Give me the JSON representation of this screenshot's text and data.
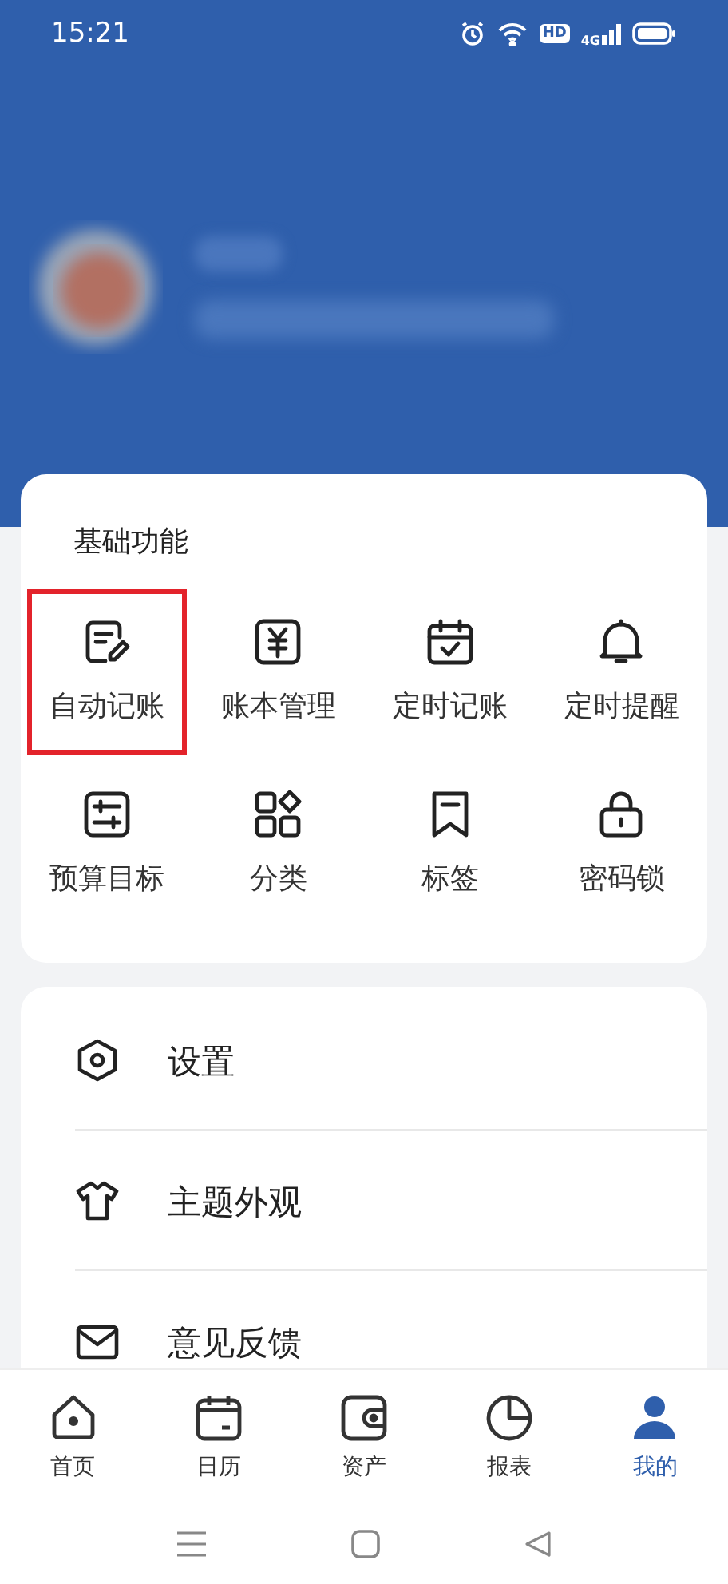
{
  "status_bar": {
    "time": "15:21",
    "hd_label": "HD",
    "network_label": "4G"
  },
  "profile": {
    "kind": "blurred"
  },
  "basic_features": {
    "title": "基础功能",
    "items": [
      {
        "label": "自动记账",
        "highlighted": true
      },
      {
        "label": "账本管理",
        "highlighted": false
      },
      {
        "label": "定时记账",
        "highlighted": false
      },
      {
        "label": "定时提醒",
        "highlighted": false
      },
      {
        "label": "预算目标",
        "highlighted": false
      },
      {
        "label": "分类",
        "highlighted": false
      },
      {
        "label": "标签",
        "highlighted": false
      },
      {
        "label": "密码锁",
        "highlighted": false
      }
    ]
  },
  "menu": [
    {
      "label": "设置"
    },
    {
      "label": "主题外观"
    },
    {
      "label": "意见反馈"
    }
  ],
  "bottom_nav": [
    {
      "label": "首页",
      "selected": false
    },
    {
      "label": "日历",
      "selected": false
    },
    {
      "label": "资产",
      "selected": false
    },
    {
      "label": "报表",
      "selected": false
    },
    {
      "label": "我的",
      "selected": true
    }
  ]
}
